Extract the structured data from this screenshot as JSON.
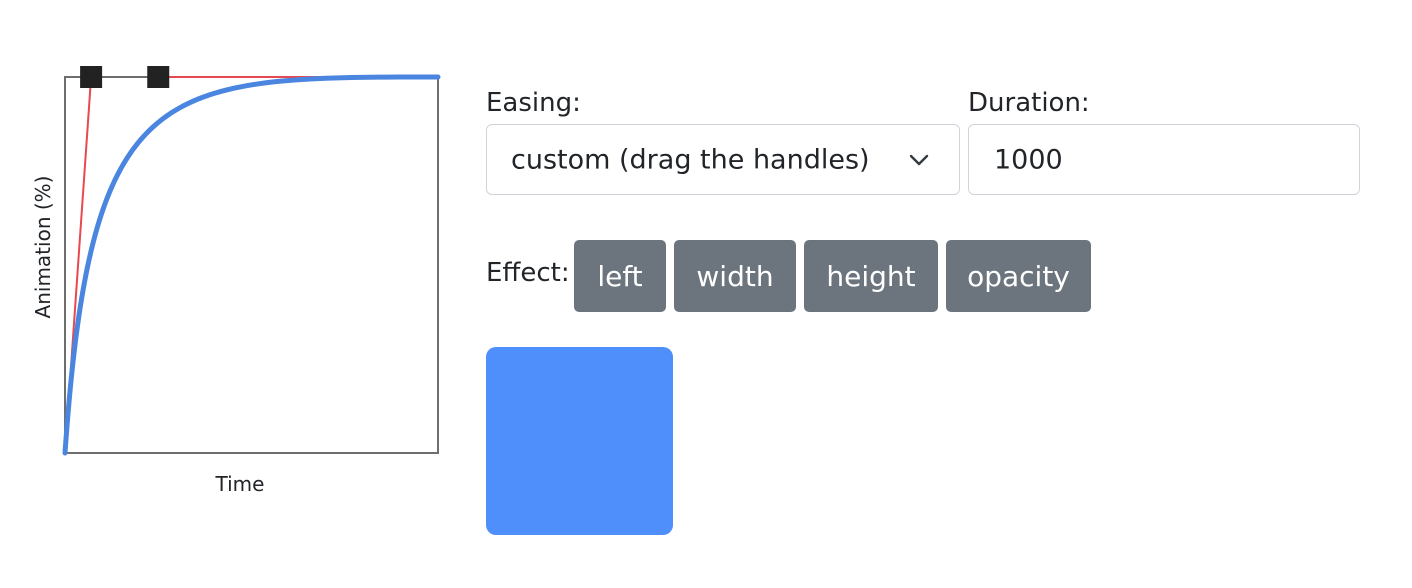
{
  "curve_editor": {
    "y_axis_label": "Animation (%)",
    "x_axis_label": "Time",
    "bezier": [
      0.07,
      1.0,
      0.25,
      1.0
    ],
    "colors": {
      "frame": "#6e6e6e",
      "control_lines": "#e8484f",
      "curve": "#4a86e0",
      "handles": "#222222"
    }
  },
  "easing": {
    "label": "Easing:",
    "selected": "custom (drag the handles)"
  },
  "duration": {
    "label": "Duration:",
    "value": "1000"
  },
  "effect": {
    "label": "Effect:",
    "buttons": [
      "left",
      "width",
      "height",
      "opacity"
    ],
    "button_color": "#6c757d"
  },
  "demo": {
    "color": "#4f8ffc"
  }
}
